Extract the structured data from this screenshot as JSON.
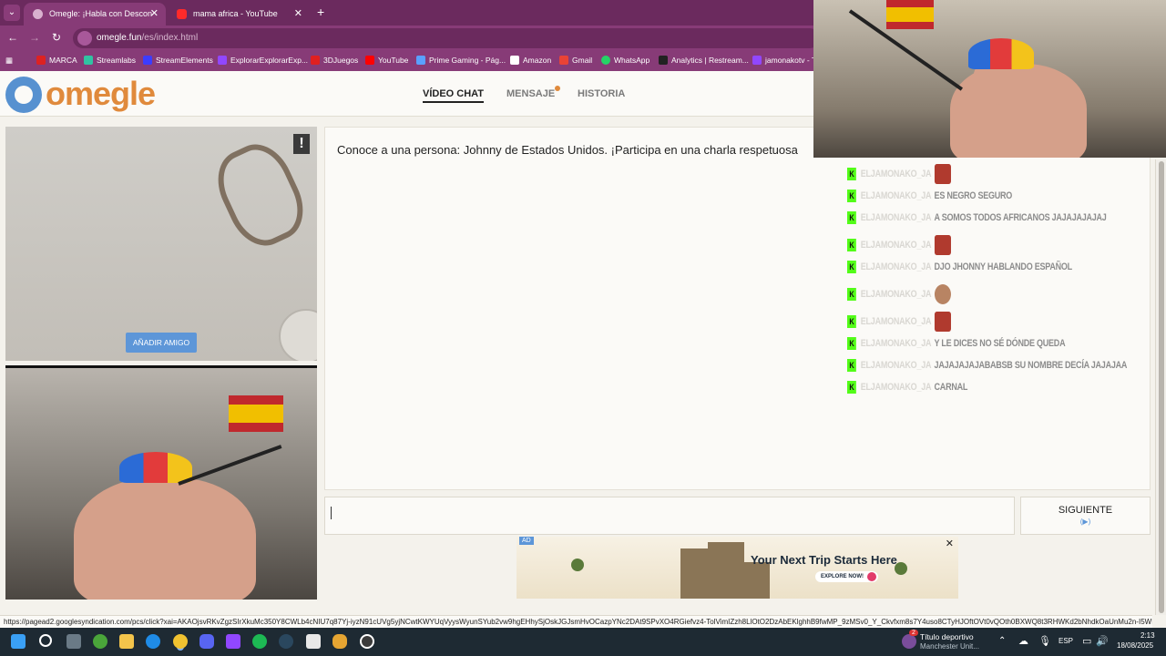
{
  "browser": {
    "tabs": [
      {
        "title": "Omegle: ¡Habla con Descon",
        "active": true
      },
      {
        "title": "mama africa - YouTube",
        "active": false
      }
    ],
    "url_host": "omegle.fun",
    "url_path": "/es/index.html",
    "bookmarks": [
      "MARCA",
      "Streamlabs",
      "StreamElements",
      "ExplorarExplorarExp...",
      "3DJuegos",
      "YouTube",
      "Prime Gaming - Pág...",
      "Amazon",
      "Gmail",
      "WhatsApp",
      "Analytics | Restream...",
      "jamonakotv - T"
    ]
  },
  "omegle": {
    "logo": "omegle",
    "nav": {
      "video_chat": "VÍDEO CHAT",
      "message": "MENSAJE",
      "history": "HISTORIA"
    },
    "add_friend": "AÑADIR AMIGO",
    "intro": "Conoce a una persona: Johnny de Estados Unidos. ¡Participa en una charla respetuosa",
    "next_button": "SIGUIENTE",
    "next_hint": "(▶)",
    "ad": {
      "badge": "AD",
      "headline": "Your Next Trip Starts Here",
      "cta": "EXPLORE NOW!"
    }
  },
  "stream_chat": [
    {
      "user": "ELJAMONAKO_JA",
      "text": "",
      "emote": "rage"
    },
    {
      "user": "ELJAMONAKO_JA",
      "text": "ES NEGRO SEGURO",
      "emote": ""
    },
    {
      "user": "ELJAMONAKO_JA",
      "text": "A SOMOS TODOS AFRICANOS JAJAJAJAJAJ",
      "emote": ""
    },
    {
      "user": "ELJAMONAKO_JA",
      "text": "",
      "emote": "rage"
    },
    {
      "user": "ELJAMONAKO_JA",
      "text": "DJO JHONNY HABLANDO ESPAÑOL",
      "emote": ""
    },
    {
      "user": "ELJAMONAKO_JA",
      "text": "",
      "emote": "face"
    },
    {
      "user": "ELJAMONAKO_JA",
      "text": "",
      "emote": "rage"
    },
    {
      "user": "ELJAMONAKO_JA",
      "text": "Y LE DICES NO SÉ DÓNDE QUEDA",
      "emote": ""
    },
    {
      "user": "ELJAMONAKO_JA",
      "text": "JAJAJAJAJABABSB SU NOMBRE DECÍA JAJAJAA",
      "emote": ""
    },
    {
      "user": "ELJAMONAKO_JA",
      "text": "CARNAL",
      "emote": ""
    }
  ],
  "status_url": "https://pagead2.googlesyndication.com/pcs/click?xai=AKAOjsvRKvZgzSIrXkuMc350Y8CWLb4cNIU7q87Yj-iyzN91cUVg5yjNCwtKWYUqVyysWyunSYub2vw9hgEHhySjOskJGJsmHvOCazpYNc2DAt9SPvXO4RGiefvz4-TolVimIZzh8LlOtO2DzAbEKlghhB9fwMP_9zMSv0_Y_Ckvfxm8s7Y4uso8CTyHJOftOVt0vQOth0BXWQ8t3RHWKd2bNhdkOaUnMu2n-I5WP1P9El",
  "taskbar": {
    "weather_title": "Título deportivo",
    "weather_sub": "Manchester Unit...",
    "lang": "ESP",
    "time": "2:13",
    "date": "18/08/2025",
    "notif_badge": "2"
  },
  "colors": {
    "chrome": "#873b77",
    "omegle_orange": "#e08a3c",
    "omegle_blue": "#5791d0",
    "kick_green": "#53fc18"
  }
}
